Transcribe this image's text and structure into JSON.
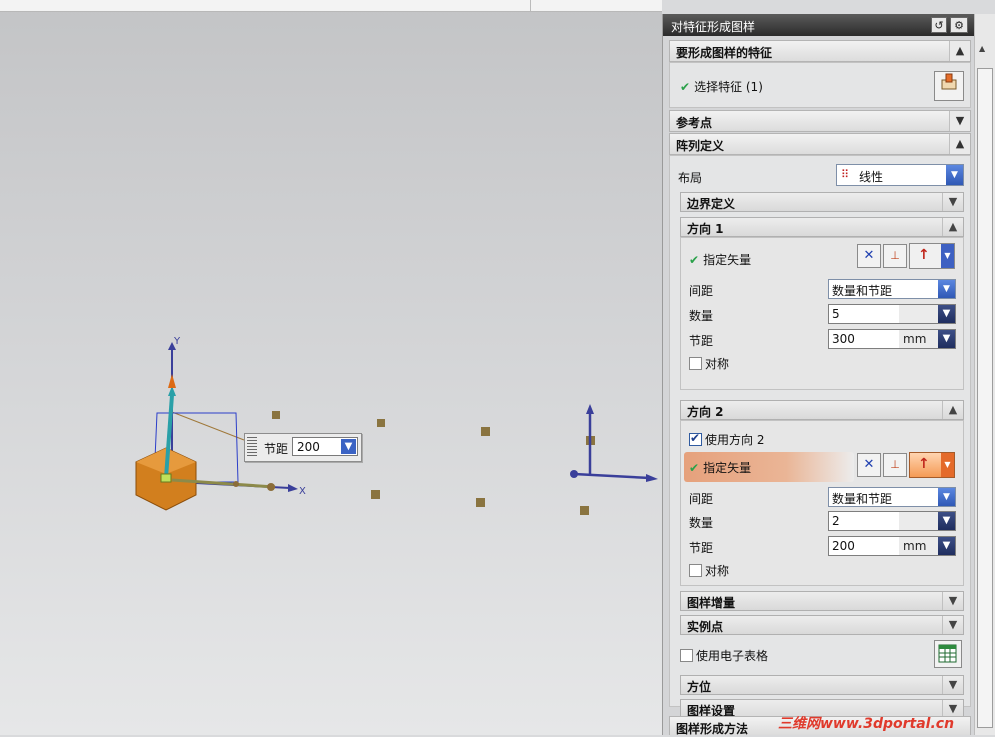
{
  "viewport": {
    "axis_y": "Y",
    "axis_x": "X",
    "pitch_label": "节距",
    "pitch_value": "200"
  },
  "panel": {
    "title": "对特征形成图样",
    "reset_icon": "reset-icon",
    "settings_icon": "gear-icon",
    "close_icon": "close-icon",
    "feature_section": {
      "title": "要形成图样的特征",
      "select_label": "选择特征 (1)"
    },
    "ref_point": {
      "title": "参考点"
    },
    "array_def": {
      "title": "阵列定义",
      "layout_label": "布局",
      "layout_value": "线性",
      "boundary": "边界定义"
    },
    "dir1": {
      "title": "方向 1",
      "vector_label": "指定矢量",
      "spacing_label": "间距",
      "spacing_value": "数量和节距",
      "count_label": "数量",
      "count_value": "5",
      "pitch_label": "节距",
      "pitch_value": "300",
      "pitch_unit": "mm",
      "symmetric_label": "对称"
    },
    "dir2": {
      "title": "方向 2",
      "use_label": "使用方向 2",
      "vector_label": "指定矢量",
      "spacing_label": "间距",
      "spacing_value": "数量和节距",
      "count_label": "数量",
      "count_value": "2",
      "pitch_label": "节距",
      "pitch_value": "200",
      "pitch_unit": "mm",
      "symmetric_label": "对称"
    },
    "increment": "图样增量",
    "instance_pts": "实例点",
    "spreadsheet_label": "使用电子表格",
    "orientation": "方位",
    "pattern_settings": "图样设置",
    "method": "图样形成方法"
  },
  "watermark": "三维网www.3dportal.cn",
  "colors": {
    "accent": "#f49a55",
    "check": "#2aa14a",
    "axis": "#3a3f9a"
  }
}
